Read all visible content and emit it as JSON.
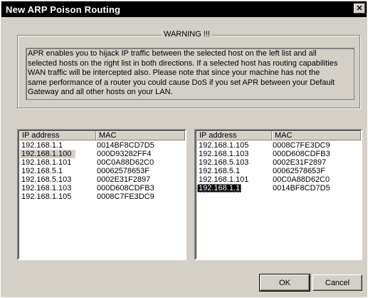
{
  "window": {
    "title": "New ARP Poison Routing",
    "close_glyph": "✕"
  },
  "warning": {
    "label": "WARNING !!!",
    "lines": [
      "APR enables you to hijack IP traffic between the selected host on the left list and all",
      "selected hosts on the right list in both directions. If a selected host has routing capabilities",
      "WAN traffic will be intercepted also. Please note that since your machine has not the",
      "same performance of a router you could cause DoS if you set APR between your Default",
      "Gateway and all other hosts on your LAN."
    ]
  },
  "left_list": {
    "columns": [
      "IP address",
      "MAC"
    ],
    "rows": [
      {
        "ip": "192.168.1.1",
        "mac": "0014BF8CD7D5"
      },
      {
        "ip": "192.168.1.100",
        "mac": "000D93282FF4"
      },
      {
        "ip": "192.168.1.101",
        "mac": "00C0A88D62C0"
      },
      {
        "ip": "192.168.5.1",
        "mac": "00062578653F"
      },
      {
        "ip": "192.168.5.103",
        "mac": "0002E31F2897"
      },
      {
        "ip": "192.168.1.103",
        "mac": "000D608CDFB3"
      },
      {
        "ip": "192.168.1.105",
        "mac": "0008C7FE3DC9"
      }
    ]
  },
  "right_list": {
    "columns": [
      "IP address",
      "MAC"
    ],
    "rows": [
      {
        "ip": "192.168.1.105",
        "mac": "0008C7FE3DC9"
      },
      {
        "ip": "192.168.1.103",
        "mac": "000D608CDFB3"
      },
      {
        "ip": "192.168.5.103",
        "mac": "0002E31F2897"
      },
      {
        "ip": "192.168.5.1",
        "mac": "00062578653F"
      },
      {
        "ip": "192.168.1.101",
        "mac": "00C0A88D62C0"
      },
      {
        "ip": "192.168.1.1",
        "mac": "0014BF8CD7D5"
      }
    ]
  },
  "buttons": {
    "ok": "OK",
    "cancel": "Cancel"
  }
}
